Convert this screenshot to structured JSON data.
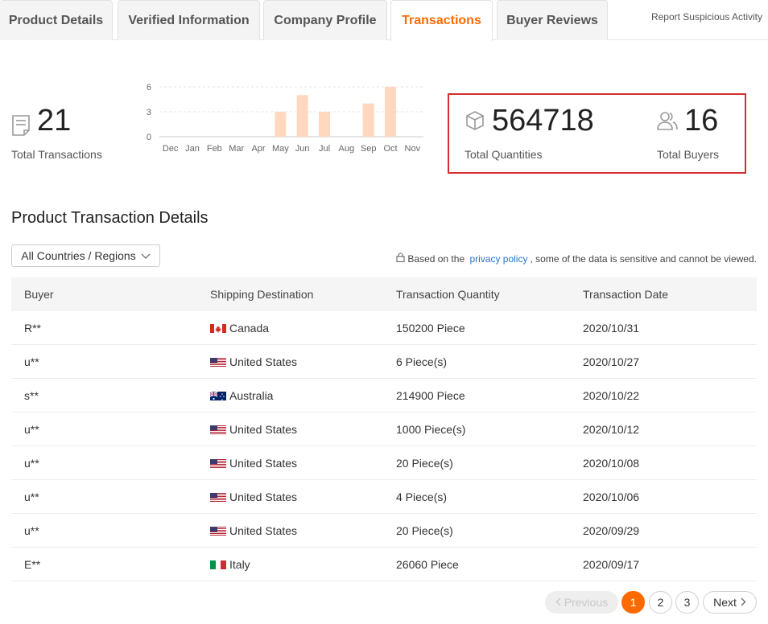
{
  "tabs": [
    {
      "label": "Product Details",
      "active": false
    },
    {
      "label": "Verified Information",
      "active": false
    },
    {
      "label": "Company Profile",
      "active": false
    },
    {
      "label": "Transactions",
      "active": true
    },
    {
      "label": "Buyer Reviews",
      "active": false
    }
  ],
  "report_link": "Report Suspicious Activity",
  "stats": {
    "transactions": {
      "value": "21",
      "label": "Total Transactions",
      "icon": "document-icon"
    },
    "quantities": {
      "value": "564718",
      "label": "Total Quantities",
      "icon": "box-icon"
    },
    "buyers": {
      "value": "16",
      "label": "Total Buyers",
      "icon": "users-icon"
    }
  },
  "chart_data": {
    "type": "bar",
    "categories": [
      "Dec",
      "Jan",
      "Feb",
      "Mar",
      "Apr",
      "May",
      "Jun",
      "Jul",
      "Aug",
      "Sep",
      "Oct",
      "Nov"
    ],
    "values": [
      0,
      0,
      0,
      0,
      0,
      3,
      5,
      3,
      0,
      4,
      6,
      0
    ],
    "yticks": [
      "0",
      "3",
      "6"
    ],
    "ylim": [
      0,
      6
    ],
    "color": "#ffd8bf",
    "grid": true
  },
  "section_title": "Product Transaction Details",
  "filter": {
    "label": "All Countries / Regions"
  },
  "privacy": {
    "prefix": "Based on the ",
    "link": "privacy policy",
    "suffix": ", some of the data is sensitive and cannot be viewed."
  },
  "table": {
    "headers": [
      "Buyer",
      "Shipping Destination",
      "Transaction Quantity",
      "Transaction Date"
    ],
    "rows": [
      {
        "buyer": "R**",
        "flag": "ca",
        "country": "Canada",
        "quantity": "150200 Piece",
        "date": "2020/10/31"
      },
      {
        "buyer": "u**",
        "flag": "us",
        "country": "United States",
        "quantity": "6 Piece(s)",
        "date": "2020/10/27"
      },
      {
        "buyer": "s**",
        "flag": "au",
        "country": "Australia",
        "quantity": "214900 Piece",
        "date": "2020/10/22"
      },
      {
        "buyer": "u**",
        "flag": "us",
        "country": "United States",
        "quantity": "1000 Piece(s)",
        "date": "2020/10/12"
      },
      {
        "buyer": "u**",
        "flag": "us",
        "country": "United States",
        "quantity": "20 Piece(s)",
        "date": "2020/10/08"
      },
      {
        "buyer": "u**",
        "flag": "us",
        "country": "United States",
        "quantity": "4 Piece(s)",
        "date": "2020/10/06"
      },
      {
        "buyer": "u**",
        "flag": "us",
        "country": "United States",
        "quantity": "20 Piece(s)",
        "date": "2020/09/29"
      },
      {
        "buyer": "E**",
        "flag": "it",
        "country": "Italy",
        "quantity": "26060 Piece",
        "date": "2020/09/17"
      }
    ]
  },
  "pagination": {
    "prev": "Previous",
    "next": "Next",
    "pages": [
      "1",
      "2",
      "3"
    ],
    "current": "1"
  },
  "colors": {
    "accent": "#ff6a00",
    "highlight_border": "#d32f2f",
    "link": "#2a72c9"
  }
}
